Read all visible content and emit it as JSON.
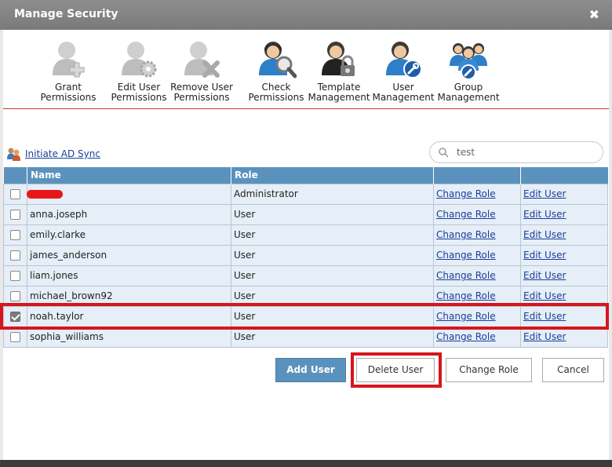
{
  "window": {
    "title": "Manage Security",
    "close_glyph": "✖"
  },
  "toolbar": {
    "items": [
      {
        "label_line1": "Grant",
        "label_line2": "Permissions",
        "icon": "user-plus-icon"
      },
      {
        "label_line1": "Edit User",
        "label_line2": "Permissions",
        "icon": "user-gear-icon"
      },
      {
        "label_line1": "Remove User",
        "label_line2": "Permissions",
        "icon": "user-remove-icon"
      },
      {
        "label_line1": "Check",
        "label_line2": "Permissions",
        "icon": "user-search-icon"
      },
      {
        "label_line1": "Template",
        "label_line2": "Management",
        "icon": "user-lock-icon"
      },
      {
        "label_line1": "User",
        "label_line2": "Management",
        "icon": "user-wrench-icon"
      },
      {
        "label_line1": "Group",
        "label_line2": "Management",
        "icon": "group-wrench-icon"
      }
    ]
  },
  "ad_sync": {
    "label": "Initiate AD Sync",
    "icon": "users-sync-icon"
  },
  "search": {
    "value": "test",
    "placeholder": "test"
  },
  "table": {
    "headers": [
      "",
      "Name",
      "Role",
      "",
      ""
    ],
    "rows": [
      {
        "name": "",
        "redacted": true,
        "role": "Administrator",
        "checked": false,
        "change_role": "Change Role",
        "edit_user": "Edit User"
      },
      {
        "name": "anna.joseph",
        "role": "User",
        "checked": false,
        "change_role": "Change Role",
        "edit_user": "Edit User"
      },
      {
        "name": "emily.clarke",
        "role": "User",
        "checked": false,
        "change_role": "Change Role",
        "edit_user": "Edit User"
      },
      {
        "name": "james_anderson",
        "role": "User",
        "checked": false,
        "change_role": "Change Role",
        "edit_user": "Edit User"
      },
      {
        "name": "liam.jones",
        "role": "User",
        "checked": false,
        "change_role": "Change Role",
        "edit_user": "Edit User"
      },
      {
        "name": "michael_brown92",
        "role": "User",
        "checked": false,
        "change_role": "Change Role",
        "edit_user": "Edit User"
      },
      {
        "name": "noah.taylor",
        "role": "User",
        "checked": true,
        "change_role": "Change Role",
        "edit_user": "Edit User"
      },
      {
        "name": "sophia_williams",
        "role": "User",
        "checked": false,
        "change_role": "Change Role",
        "edit_user": "Edit User"
      }
    ]
  },
  "buttons": {
    "add_user": "Add User",
    "delete_user": "Delete User",
    "change_role": "Change Role",
    "cancel": "Cancel"
  },
  "colors": {
    "header_blue": "#5b92bd",
    "row_bg": "#e6eef7",
    "highlight_red": "#d5161c",
    "link_blue": "#1b3f99",
    "accent_red_line": "#d23434"
  }
}
